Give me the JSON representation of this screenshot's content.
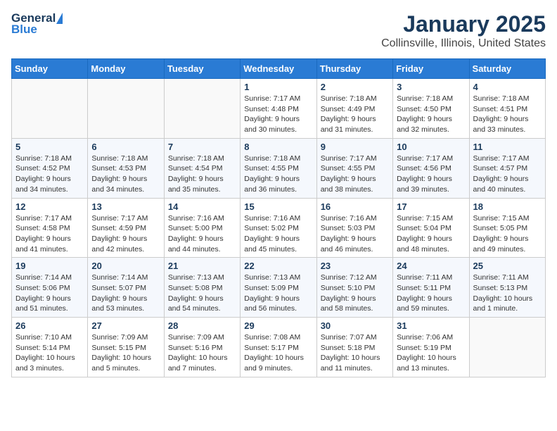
{
  "header": {
    "logo_general": "General",
    "logo_blue": "Blue",
    "title": "January 2025",
    "subtitle": "Collinsville, Illinois, United States"
  },
  "days_of_week": [
    "Sunday",
    "Monday",
    "Tuesday",
    "Wednesday",
    "Thursday",
    "Friday",
    "Saturday"
  ],
  "weeks": [
    [
      {
        "day": "",
        "data": ""
      },
      {
        "day": "",
        "data": ""
      },
      {
        "day": "",
        "data": ""
      },
      {
        "day": "1",
        "data": "Sunrise: 7:17 AM\nSunset: 4:48 PM\nDaylight: 9 hours and 30 minutes."
      },
      {
        "day": "2",
        "data": "Sunrise: 7:18 AM\nSunset: 4:49 PM\nDaylight: 9 hours and 31 minutes."
      },
      {
        "day": "3",
        "data": "Sunrise: 7:18 AM\nSunset: 4:50 PM\nDaylight: 9 hours and 32 minutes."
      },
      {
        "day": "4",
        "data": "Sunrise: 7:18 AM\nSunset: 4:51 PM\nDaylight: 9 hours and 33 minutes."
      }
    ],
    [
      {
        "day": "5",
        "data": "Sunrise: 7:18 AM\nSunset: 4:52 PM\nDaylight: 9 hours and 34 minutes."
      },
      {
        "day": "6",
        "data": "Sunrise: 7:18 AM\nSunset: 4:53 PM\nDaylight: 9 hours and 34 minutes."
      },
      {
        "day": "7",
        "data": "Sunrise: 7:18 AM\nSunset: 4:54 PM\nDaylight: 9 hours and 35 minutes."
      },
      {
        "day": "8",
        "data": "Sunrise: 7:18 AM\nSunset: 4:55 PM\nDaylight: 9 hours and 36 minutes."
      },
      {
        "day": "9",
        "data": "Sunrise: 7:17 AM\nSunset: 4:55 PM\nDaylight: 9 hours and 38 minutes."
      },
      {
        "day": "10",
        "data": "Sunrise: 7:17 AM\nSunset: 4:56 PM\nDaylight: 9 hours and 39 minutes."
      },
      {
        "day": "11",
        "data": "Sunrise: 7:17 AM\nSunset: 4:57 PM\nDaylight: 9 hours and 40 minutes."
      }
    ],
    [
      {
        "day": "12",
        "data": "Sunrise: 7:17 AM\nSunset: 4:58 PM\nDaylight: 9 hours and 41 minutes."
      },
      {
        "day": "13",
        "data": "Sunrise: 7:17 AM\nSunset: 4:59 PM\nDaylight: 9 hours and 42 minutes."
      },
      {
        "day": "14",
        "data": "Sunrise: 7:16 AM\nSunset: 5:00 PM\nDaylight: 9 hours and 44 minutes."
      },
      {
        "day": "15",
        "data": "Sunrise: 7:16 AM\nSunset: 5:02 PM\nDaylight: 9 hours and 45 minutes."
      },
      {
        "day": "16",
        "data": "Sunrise: 7:16 AM\nSunset: 5:03 PM\nDaylight: 9 hours and 46 minutes."
      },
      {
        "day": "17",
        "data": "Sunrise: 7:15 AM\nSunset: 5:04 PM\nDaylight: 9 hours and 48 minutes."
      },
      {
        "day": "18",
        "data": "Sunrise: 7:15 AM\nSunset: 5:05 PM\nDaylight: 9 hours and 49 minutes."
      }
    ],
    [
      {
        "day": "19",
        "data": "Sunrise: 7:14 AM\nSunset: 5:06 PM\nDaylight: 9 hours and 51 minutes."
      },
      {
        "day": "20",
        "data": "Sunrise: 7:14 AM\nSunset: 5:07 PM\nDaylight: 9 hours and 53 minutes."
      },
      {
        "day": "21",
        "data": "Sunrise: 7:13 AM\nSunset: 5:08 PM\nDaylight: 9 hours and 54 minutes."
      },
      {
        "day": "22",
        "data": "Sunrise: 7:13 AM\nSunset: 5:09 PM\nDaylight: 9 hours and 56 minutes."
      },
      {
        "day": "23",
        "data": "Sunrise: 7:12 AM\nSunset: 5:10 PM\nDaylight: 9 hours and 58 minutes."
      },
      {
        "day": "24",
        "data": "Sunrise: 7:11 AM\nSunset: 5:11 PM\nDaylight: 9 hours and 59 minutes."
      },
      {
        "day": "25",
        "data": "Sunrise: 7:11 AM\nSunset: 5:13 PM\nDaylight: 10 hours and 1 minute."
      }
    ],
    [
      {
        "day": "26",
        "data": "Sunrise: 7:10 AM\nSunset: 5:14 PM\nDaylight: 10 hours and 3 minutes."
      },
      {
        "day": "27",
        "data": "Sunrise: 7:09 AM\nSunset: 5:15 PM\nDaylight: 10 hours and 5 minutes."
      },
      {
        "day": "28",
        "data": "Sunrise: 7:09 AM\nSunset: 5:16 PM\nDaylight: 10 hours and 7 minutes."
      },
      {
        "day": "29",
        "data": "Sunrise: 7:08 AM\nSunset: 5:17 PM\nDaylight: 10 hours and 9 minutes."
      },
      {
        "day": "30",
        "data": "Sunrise: 7:07 AM\nSunset: 5:18 PM\nDaylight: 10 hours and 11 minutes."
      },
      {
        "day": "31",
        "data": "Sunrise: 7:06 AM\nSunset: 5:19 PM\nDaylight: 10 hours and 13 minutes."
      },
      {
        "day": "",
        "data": ""
      }
    ]
  ]
}
